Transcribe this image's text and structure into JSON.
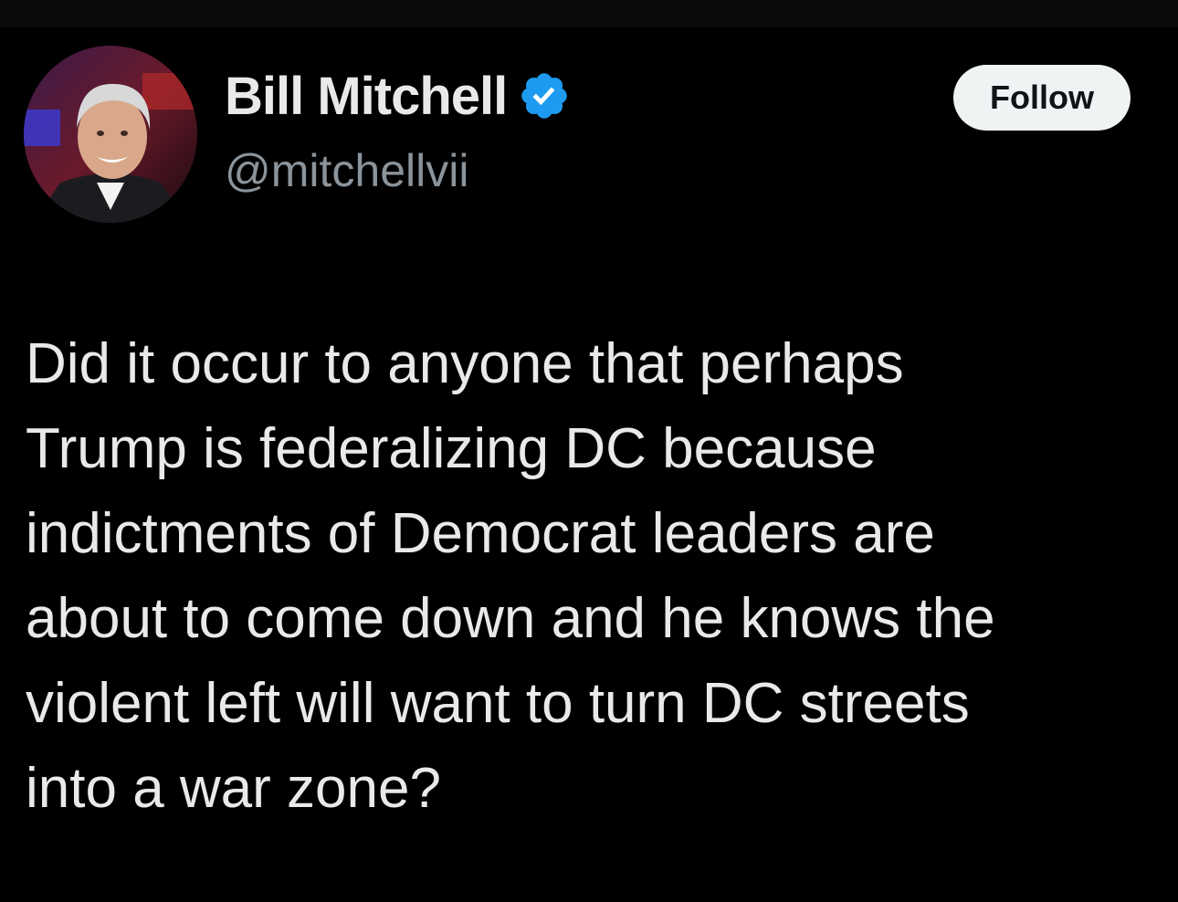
{
  "author": {
    "name": "Bill Mitchell",
    "handle": "@mitchellvii",
    "verified": true,
    "avatar_icon": "profile-photo"
  },
  "actions": {
    "follow_label": "Follow"
  },
  "tweet": {
    "text": "Did it occur to anyone that perhaps\nTrump is federalizing DC because\nindictments of Democrat leaders are\nabout to come down and he knows the\nviolent left will want to turn DC streets\ninto a war zone?"
  },
  "colors": {
    "background": "#000000",
    "text_primary": "#e7e9ea",
    "text_secondary": "#8b949b",
    "verified_blue": "#1d9bf0",
    "follow_button_bg": "#eff3f4",
    "follow_button_text": "#0f1419"
  }
}
